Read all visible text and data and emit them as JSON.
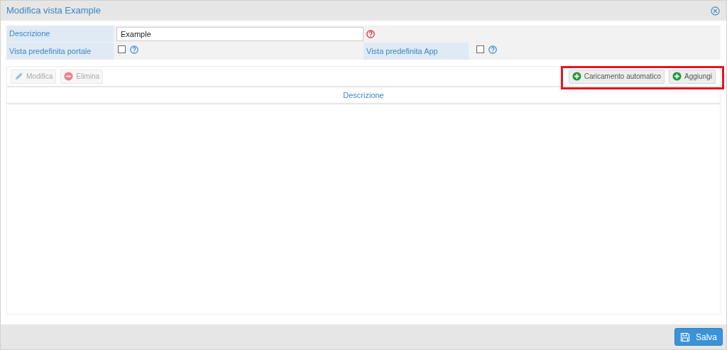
{
  "window": {
    "title": "Modifica vista Example"
  },
  "form": {
    "description": {
      "label": "Descrizione",
      "value": "Example"
    },
    "portal_default": {
      "label": "Vista predefinita portale",
      "checked": false
    },
    "app_default": {
      "label": "Vista predefinita App",
      "checked": false
    }
  },
  "toolbar_left": [
    {
      "label": "Modifica",
      "kind": "edit",
      "disabled": true
    },
    {
      "label": "Elimina",
      "kind": "delete",
      "disabled": true
    }
  ],
  "toolbar_right": [
    {
      "label": "Caricamento automatico",
      "kind": "add",
      "disabled": false
    },
    {
      "label": "Aggiungi",
      "kind": "add",
      "disabled": false
    }
  ],
  "table": {
    "columns": [
      "Descrizione"
    ]
  },
  "footer": {
    "buttons": [
      "Salva"
    ]
  }
}
